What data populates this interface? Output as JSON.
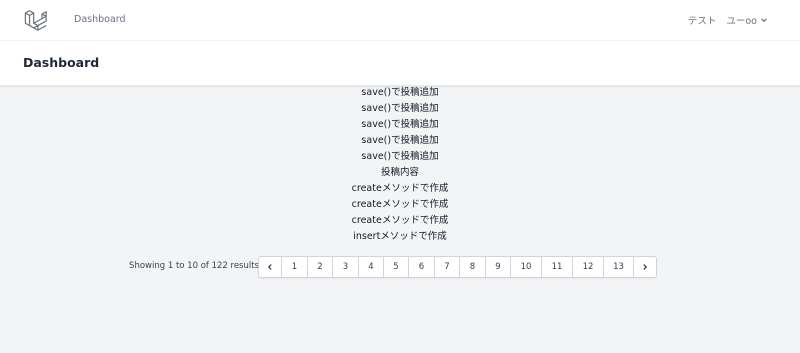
{
  "nav": {
    "dashboard_link": "Dashboard",
    "test_link": "テスト",
    "user_name": "ユーoo"
  },
  "header": {
    "title": "Dashboard"
  },
  "posts": [
    "save()で投稿追加",
    "save()で投稿追加",
    "save()で投稿追加",
    "save()で投稿追加",
    "save()で投稿追加",
    "投稿内容",
    "createメソッドで作成",
    "createメソッドで作成",
    "createメソッドで作成",
    "insertメソッドで作成"
  ],
  "pagination": {
    "results_text": "Showing 1 to 10 of 122 results",
    "pages": [
      "1",
      "2",
      "3",
      "4",
      "5",
      "6",
      "7",
      "8",
      "9",
      "10",
      "11",
      "12",
      "13"
    ]
  },
  "colors": {
    "brand_logo": "#6b7280",
    "background": "#f3f4f6"
  }
}
